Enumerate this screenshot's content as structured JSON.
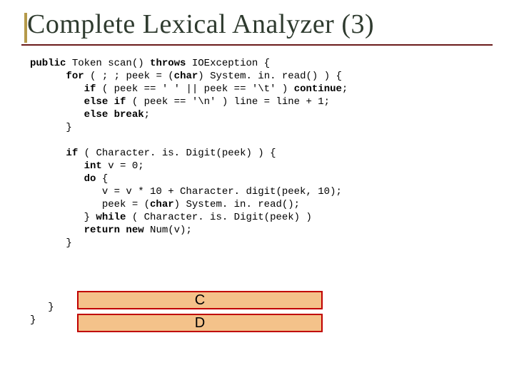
{
  "title": "Complete Lexical Analyzer (3)",
  "code": {
    "l1": "public",
    "l1b": " Token scan() ",
    "l1c": "throws",
    "l1d": " IOException {",
    "l2a": "      ",
    "l2b": "for",
    "l2c": " ( ; ; peek = (",
    "l2d": "char",
    "l2e": ") System. in. read() ) {",
    "l3a": "         ",
    "l3b": "if",
    "l3c": " ( peek == ' ' || peek == '\\t' ) ",
    "l3d": "continue",
    "l3e": ";",
    "l4a": "         ",
    "l4b": "else if",
    "l4c": " ( peek == '\\n' ) line = line + 1;",
    "l5a": "         ",
    "l5b": "else break",
    "l5c": ";",
    "l6": "      }",
    "l7": "",
    "l8a": "      ",
    "l8b": "if",
    "l8c": " ( Character. is. Digit(peek) ) {",
    "l9a": "         ",
    "l9b": "int",
    "l9c": " v = 0;",
    "l10a": "         ",
    "l10b": "do",
    "l10c": " {",
    "l11": "            v = v * 10 + Character. digit(peek, 10);",
    "l12a": "            peek = (",
    "l12b": "char",
    "l12c": ") System. in. read();",
    "l13a": "         } ",
    "l13b": "while",
    "l13c": " ( Character. is. Digit(peek) )",
    "l14a": "         ",
    "l14b": "return new",
    "l14c": " Num(v);",
    "l15": "      }",
    "l16": "",
    "l17": "",
    "l18": "",
    "l19": "",
    "l20": "   }",
    "l21": "}"
  },
  "boxC": "C",
  "boxD": "D"
}
